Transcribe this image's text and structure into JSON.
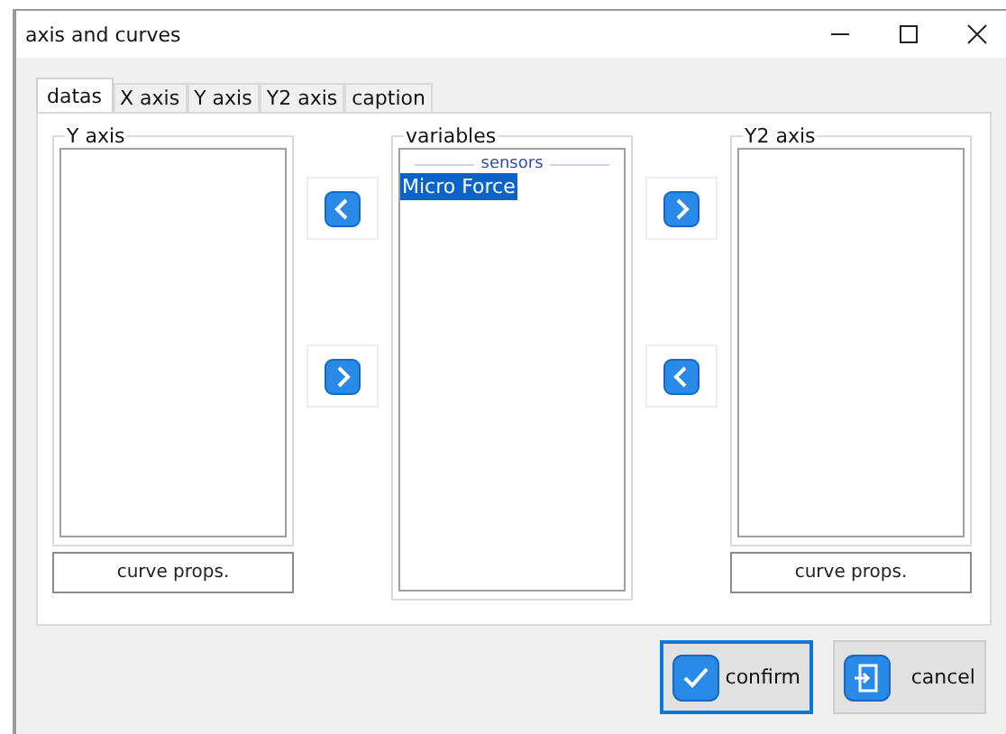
{
  "window": {
    "title": "axis and curves"
  },
  "tabs": [
    {
      "label": "datas",
      "selected": true
    },
    {
      "label": "X axis",
      "selected": false
    },
    {
      "label": "Y axis",
      "selected": false
    },
    {
      "label": "Y2 axis",
      "selected": false
    },
    {
      "label": "caption",
      "selected": false
    }
  ],
  "y_axis": {
    "title": "Y axis",
    "button": "curve props."
  },
  "left_arrows": [
    {
      "kind": "left"
    },
    {
      "kind": "right"
    }
  ],
  "variables": {
    "title": "variables",
    "section": "sensors",
    "items": [
      {
        "label": "Micro Force",
        "selected": true
      }
    ]
  },
  "right_arrows": [
    {
      "kind": "right"
    },
    {
      "kind": "left"
    }
  ],
  "y2_axis": {
    "title": "Y2 axis",
    "button": "curve props."
  },
  "buttons": [
    {
      "label": "confirm",
      "kind": "confirm",
      "focused": true
    },
    {
      "label": "cancel",
      "kind": "cancel",
      "focused": false
    }
  ]
}
